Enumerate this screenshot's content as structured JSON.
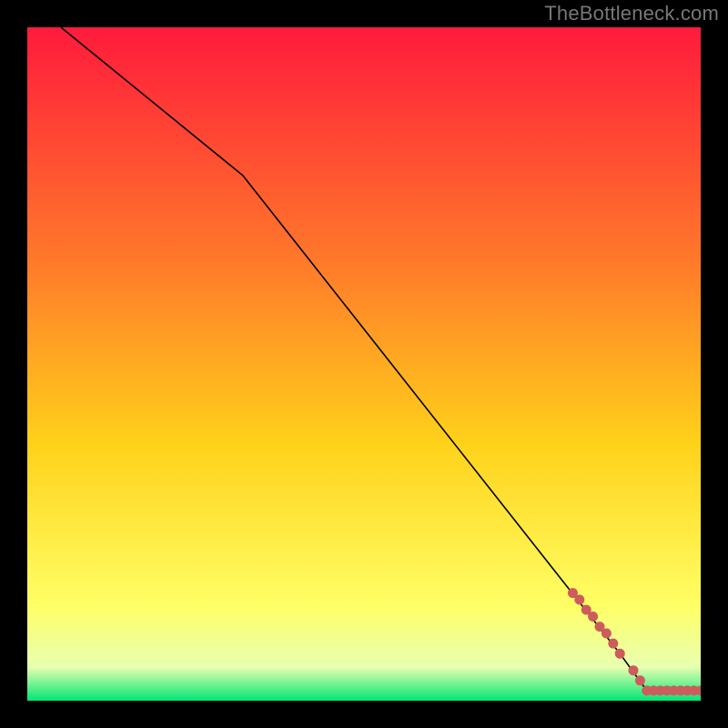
{
  "watermark": "TheBottleneck.com",
  "colors": {
    "gradient_top": "#ff1a3c",
    "gradient_mid_upper": "#ff7a2a",
    "gradient_mid": "#ffd21a",
    "gradient_mid_lower": "#ffff66",
    "gradient_lower": "#e8ffb0",
    "gradient_bottom": "#00e676",
    "frame": "#000000",
    "curve": "#000000",
    "dots": "#cd5c5c"
  },
  "chart_data": {
    "type": "line",
    "title": "",
    "xlabel": "",
    "ylabel": "",
    "xlim": [
      0,
      100
    ],
    "ylim": [
      0,
      100
    ],
    "series": [
      {
        "name": "curve",
        "x": [
          5,
          32,
          88,
          92,
          100
        ],
        "y": [
          100,
          78,
          7,
          1.5,
          1.5
        ]
      }
    ],
    "points": {
      "name": "along-curve-markers",
      "x": [
        81,
        82,
        83,
        84,
        85,
        86,
        87,
        88,
        90,
        91,
        92,
        93,
        94,
        95,
        96,
        97,
        98,
        99,
        100
      ],
      "y": [
        16,
        15,
        13.5,
        12.5,
        11,
        10,
        8.5,
        7,
        4.5,
        3,
        1.5,
        1.5,
        1.5,
        1.5,
        1.5,
        1.5,
        1.5,
        1.5,
        1.5
      ]
    }
  }
}
